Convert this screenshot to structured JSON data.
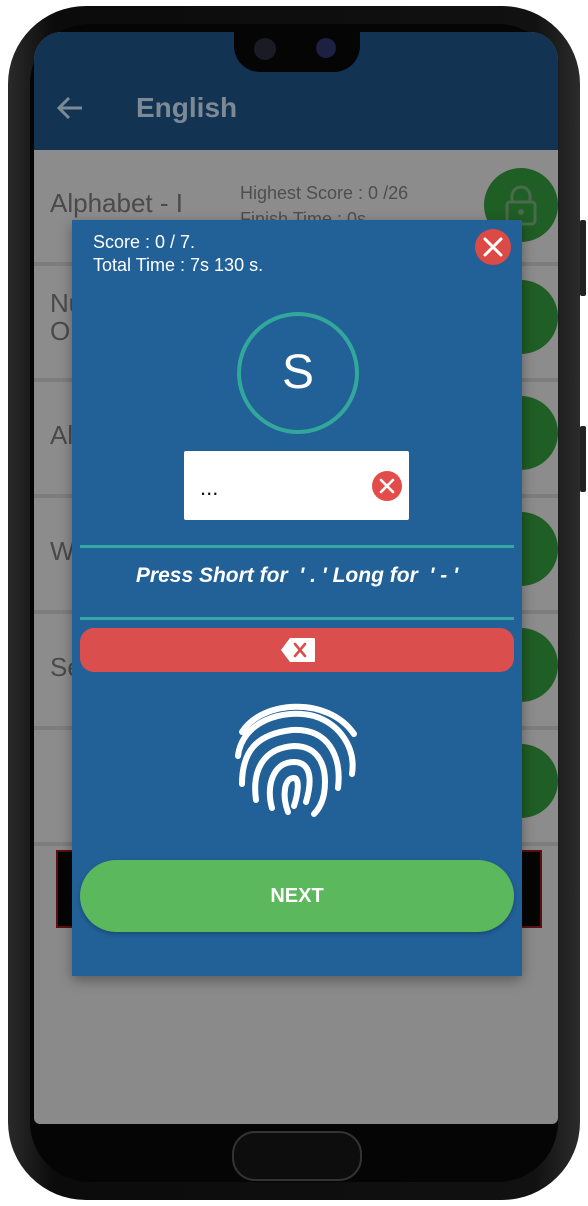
{
  "app": {
    "title": "English"
  },
  "list": [
    {
      "title": "Alphabet - I",
      "meta1": "Highest Score : 0 /26",
      "meta2": "Finish Time    : 0s"
    },
    {
      "title": "Nu",
      "title2": "Op"
    },
    {
      "title": "Al"
    },
    {
      "title": "W"
    },
    {
      "title": "Se"
    },
    {
      "title": ""
    }
  ],
  "modal": {
    "score": "Score : 0 / 7.",
    "total_time": "Total Time : 7s 130 s.",
    "letter": "S",
    "input_value": "...",
    "instruction": "Press Short for  ' . ' Long for  ' - '",
    "next_label": "NEXT"
  },
  "icons": {
    "back": "arrow-left-icon",
    "lock": "lock-icon",
    "close": "close-icon",
    "clear": "clear-icon",
    "backspace": "backspace-icon",
    "fingerprint": "fingerprint-icon"
  },
  "colors": {
    "modal_bg": "#226098",
    "accent_teal": "#32a89b",
    "danger": "#da4f4d",
    "success": "#5cb85c",
    "appbar": "#133352"
  }
}
